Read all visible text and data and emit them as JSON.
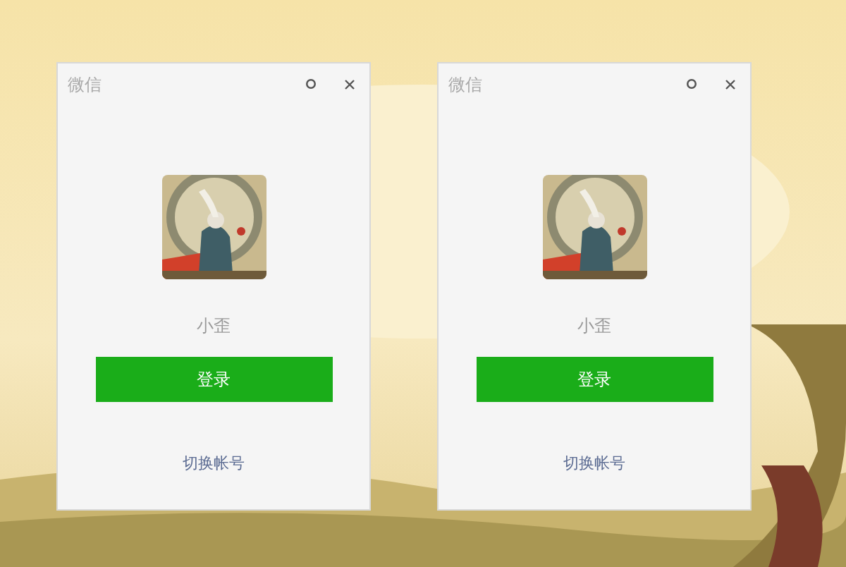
{
  "windows": [
    {
      "title": "微信",
      "name": "小歪",
      "login_button": "登录",
      "switch_link": "切换帐号"
    },
    {
      "title": "微信",
      "name": "小歪",
      "login_button": "登录",
      "switch_link": "切换帐号"
    }
  ]
}
